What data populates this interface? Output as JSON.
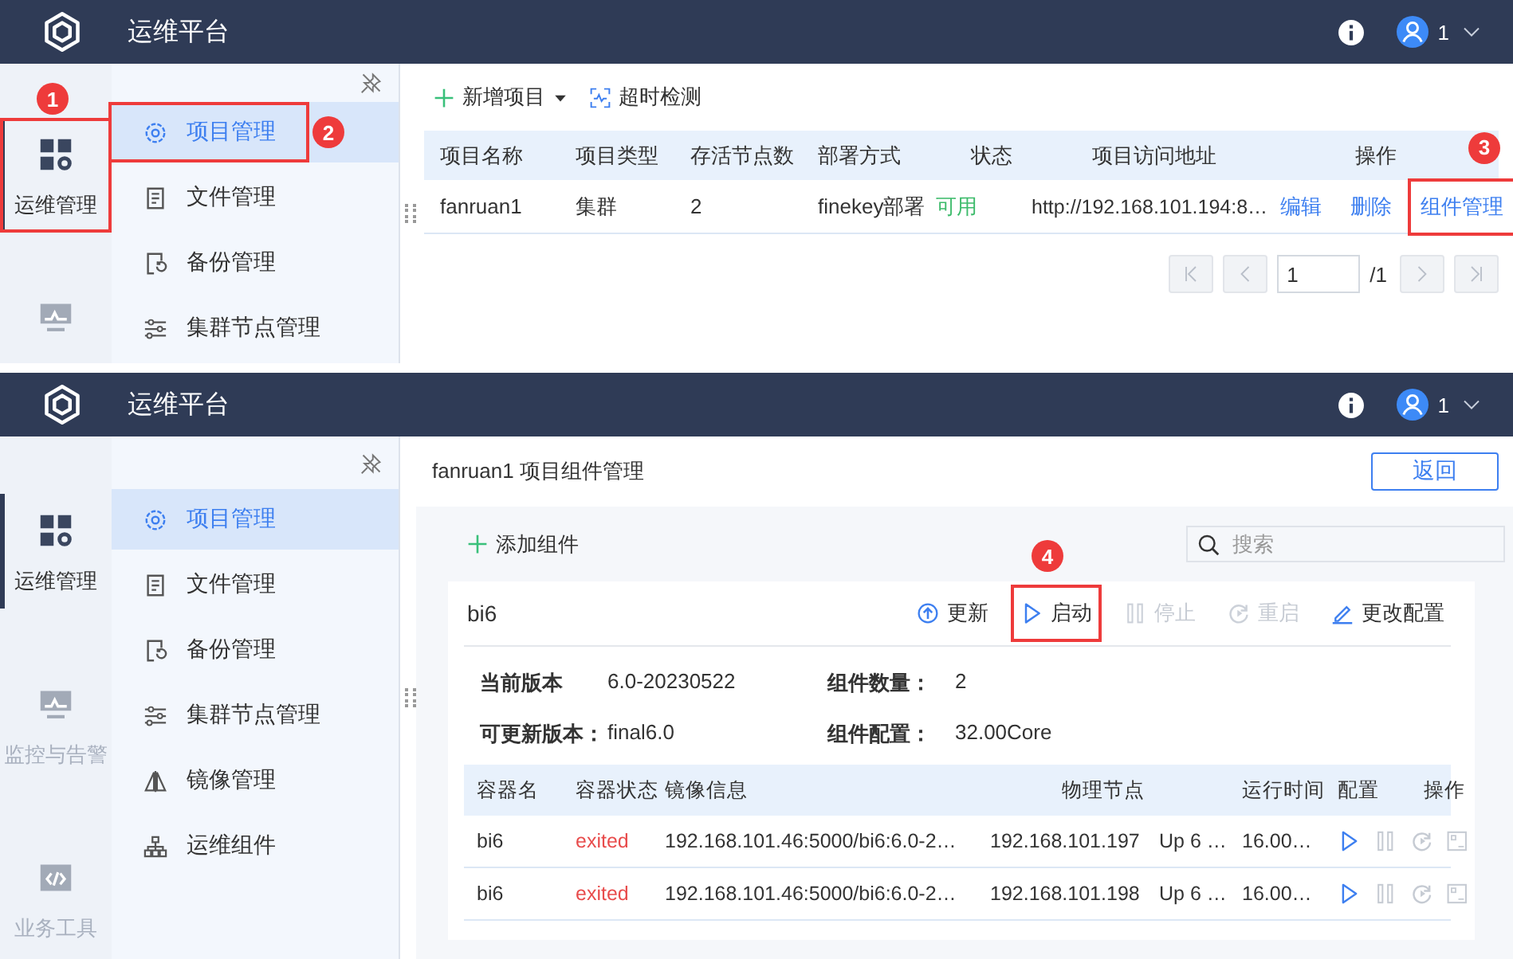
{
  "panels": [
    {
      "kind": "projects",
      "header": {
        "title": "运维平台",
        "user": "1"
      },
      "rail": [
        {
          "label": "运维管理",
          "selected": true,
          "callout": "1"
        },
        {
          "selected": false
        }
      ],
      "nav": [
        {
          "label": "项目管理",
          "selected": true,
          "callout": "2"
        },
        {
          "label": "文件管理",
          "selected": false
        },
        {
          "label": "备份管理",
          "selected": false
        },
        {
          "label": "集群节点管理",
          "selected": false
        }
      ],
      "toolbar": [
        {
          "label": "新增项目",
          "dropdown": true
        },
        {
          "label": "超时检测",
          "dropdown": false
        }
      ],
      "table": {
        "columns": [
          "项目名称",
          "项目类型",
          "存活节点数",
          "部署方式",
          "状态",
          "项目访问地址",
          "操作"
        ],
        "rows": [
          {
            "cells": [
              "fanruan1",
              "集群",
              "2",
              "finekey部署"
            ],
            "status": {
              "text": "可用",
              "color": "#3dbb6b"
            },
            "url": "http://192.168.101.194:8…",
            "actions": [
              {
                "label": "编辑"
              },
              {
                "label": "删除"
              },
              {
                "label": "组件管理",
                "callout": "3"
              }
            ]
          }
        ]
      },
      "pagination": {
        "page": "1",
        "total": "/1"
      }
    },
    {
      "kind": "components",
      "header": {
        "title": "运维平台",
        "user": "1"
      },
      "rail": [
        {
          "label": "运维管理",
          "selected": true
        },
        {
          "label": "监控与告警",
          "selected": false
        },
        {
          "label": "业务工具",
          "selected": false
        }
      ],
      "nav": [
        {
          "label": "项目管理",
          "selected": true
        },
        {
          "label": "文件管理",
          "selected": false
        },
        {
          "label": "备份管理",
          "selected": false
        },
        {
          "label": "集群节点管理",
          "selected": false
        },
        {
          "label": "镜像管理",
          "selected": false
        },
        {
          "label": "运维组件",
          "selected": false
        }
      ],
      "title": "fanruan1 项目组件管理",
      "back": "返回",
      "add": "添加组件",
      "search": {
        "placeholder": "搜索"
      },
      "card": {
        "name": "bi6",
        "actions": [
          {
            "label": "更新",
            "disabled": false
          },
          {
            "label": "启动",
            "disabled": false,
            "callout": "4"
          },
          {
            "label": "停止",
            "disabled": true
          },
          {
            "label": "重启",
            "disabled": true
          },
          {
            "label": "更改配置",
            "disabled": false
          }
        ],
        "info": [
          {
            "label": "当前版本",
            "value": "6.0-20230522"
          },
          {
            "label": "组件数量：",
            "value": "2"
          },
          {
            "label": "可更新版本：",
            "value": "final6.0"
          },
          {
            "label": "组件配置：",
            "value": "32.00Core"
          }
        ],
        "table": {
          "columns": [
            "容器名",
            "容器状态",
            "镜像信息",
            "物理节点",
            "运行时间",
            "配置",
            "操作"
          ],
          "rows": [
            {
              "cells": [
                "bi6"
              ],
              "status": {
                "text": "exited",
                "color": "#e84c4c"
              },
              "more": [
                "192.168.101.46:5000/bi6:6.0-2…",
                "192.168.101.197",
                "Up 6 …",
                "16.00…"
              ],
              "actions": [
                {
                  "disabled": false
                },
                {
                  "disabled": true
                },
                {
                  "disabled": true
                },
                {
                  "disabled": true
                }
              ]
            },
            {
              "cells": [
                "bi6"
              ],
              "status": {
                "text": "exited",
                "color": "#e84c4c"
              },
              "more": [
                "192.168.101.46:5000/bi6:6.0-2…",
                "192.168.101.198",
                "Up 6 …",
                "16.00…"
              ],
              "actions": [
                {
                  "disabled": false
                },
                {
                  "disabled": true
                },
                {
                  "disabled": true
                },
                {
                  "disabled": true
                }
              ]
            }
          ]
        }
      }
    }
  ]
}
